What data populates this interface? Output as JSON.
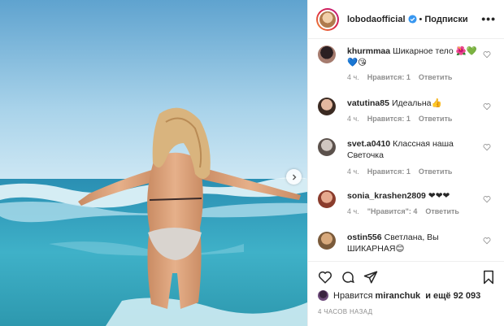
{
  "post": {
    "username": "lobodaofficial",
    "follow_label": "Подписки",
    "separator": "•",
    "more_label": "•••"
  },
  "comments": [
    {
      "username": "khurmmaa",
      "text": "Шикарное тело 🌺💚💙😘",
      "time": "4 ч.",
      "likes": "Нравится: 1",
      "reply": "Ответить"
    },
    {
      "username": "vatutina85",
      "text": "Идеальна👍",
      "time": "4 ч.",
      "likes": "Нравится: 1",
      "reply": "Ответить"
    },
    {
      "username": "svet.a0410",
      "text": "Классная наша Светочка",
      "time": "4 ч.",
      "likes": "Нравится: 1",
      "reply": "Ответить"
    },
    {
      "username": "sonia_krashen2809",
      "text": "❤❤❤",
      "time": "4 ч.",
      "likes": "\"Нравится\": 4",
      "reply": "Ответить"
    },
    {
      "username": "ostin556",
      "text": "Светлана, Вы ШИКАРНАЯ😊",
      "time": "",
      "likes": "",
      "reply": ""
    }
  ],
  "likes_line": {
    "prefix": "Нравится",
    "user": "miranchuk",
    "suffix": "и ещё 92 093"
  },
  "timestamp": "4 ЧАСОВ НАЗАД",
  "colors": {
    "verified": "#3897f0",
    "muted": "#8e8e8e",
    "text": "#262626"
  }
}
